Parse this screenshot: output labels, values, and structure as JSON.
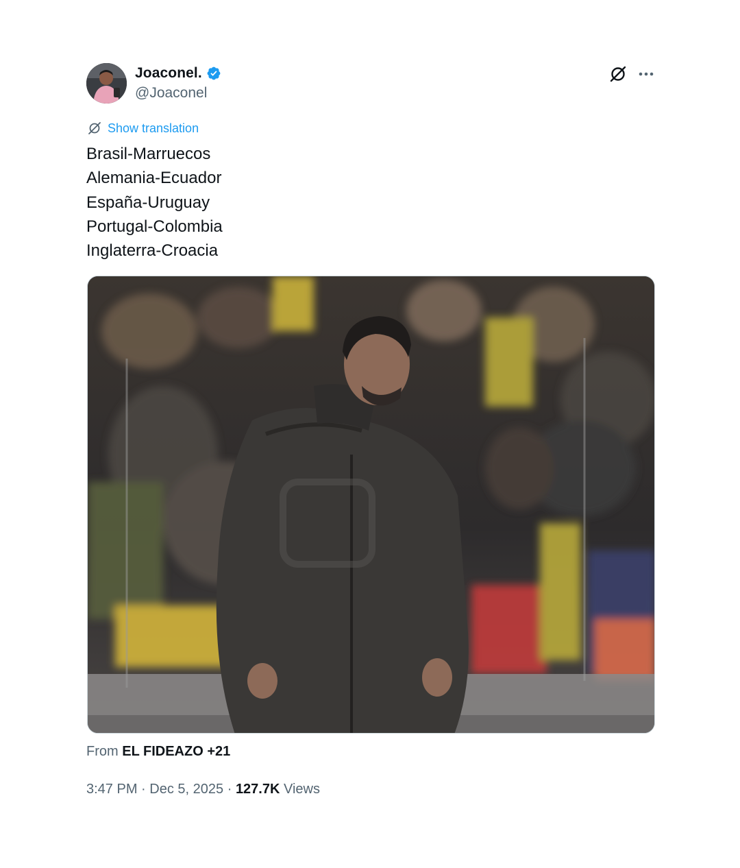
{
  "author": {
    "display_name": "Joaconel.",
    "handle": "@Joaconel",
    "verified": true
  },
  "icons": {
    "avatar": "profile-photo",
    "verified": "verified-badge-icon",
    "grok": "grok-icon",
    "more": "more-icon",
    "translate": "translate-icon"
  },
  "translate": {
    "label": "Show translation"
  },
  "tweet": {
    "lines": [
      "Brasil-Marruecos",
      "Alemania-Ecuador",
      "España-Uruguay",
      "Portugal-Colombia",
      "Inglaterra-Croacia"
    ]
  },
  "media": {
    "type": "video"
  },
  "source": {
    "prefix": "From",
    "name": "EL FIDEAZO +21"
  },
  "meta": {
    "time": "3:47 PM",
    "separator": "·",
    "date": "Dec 5, 2025",
    "views_count": "127.7K",
    "views_label": "Views"
  },
  "colors": {
    "accent": "#1d9bf0",
    "text_primary": "#0f1419",
    "text_secondary": "#536471",
    "border": "#cfd9de"
  }
}
